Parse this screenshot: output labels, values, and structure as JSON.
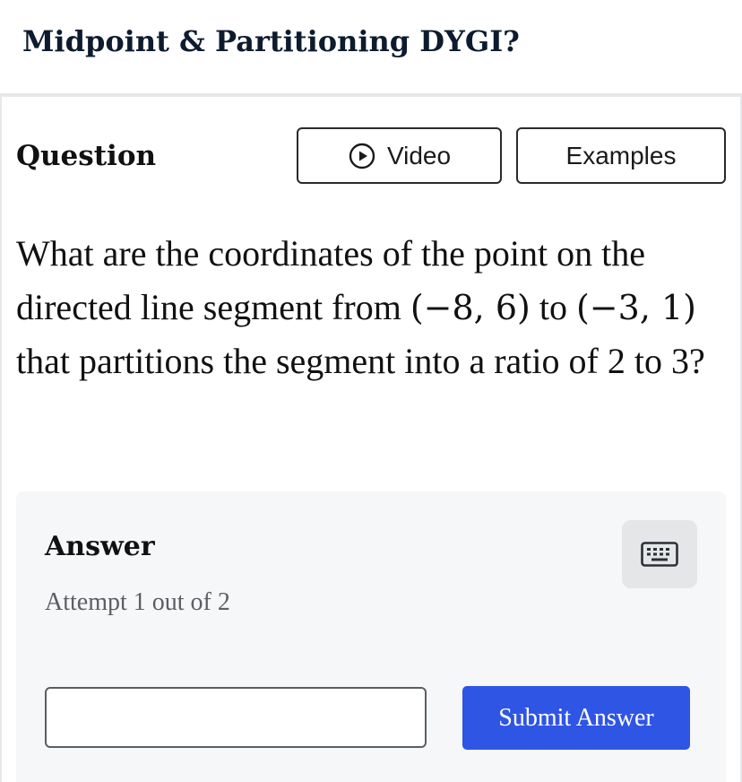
{
  "header": {
    "title": "Midpoint & Partitioning DYGI?"
  },
  "question": {
    "heading": "Question",
    "tabs": {
      "video_label": "Video",
      "examples_label": "Examples"
    },
    "text_parts": {
      "p1": "What are the coordinates of the point on the directed line segment from ",
      "point_a": "(−8, 6)",
      "p2": " to ",
      "point_b": "(−3, 1)",
      "p3": " that partitions the segment into a ratio of 2 to 3?"
    }
  },
  "answer": {
    "heading": "Answer",
    "attempt_text": "Attempt 1 out of 2",
    "input_value": "",
    "submit_label": "Submit Answer",
    "keyboard_icon": "keyboard-icon"
  },
  "colors": {
    "primary_button": "#2f55e4",
    "panel_background": "#f6f7f9",
    "title_color": "#0d1b2e",
    "muted_text": "#5b5e63"
  }
}
